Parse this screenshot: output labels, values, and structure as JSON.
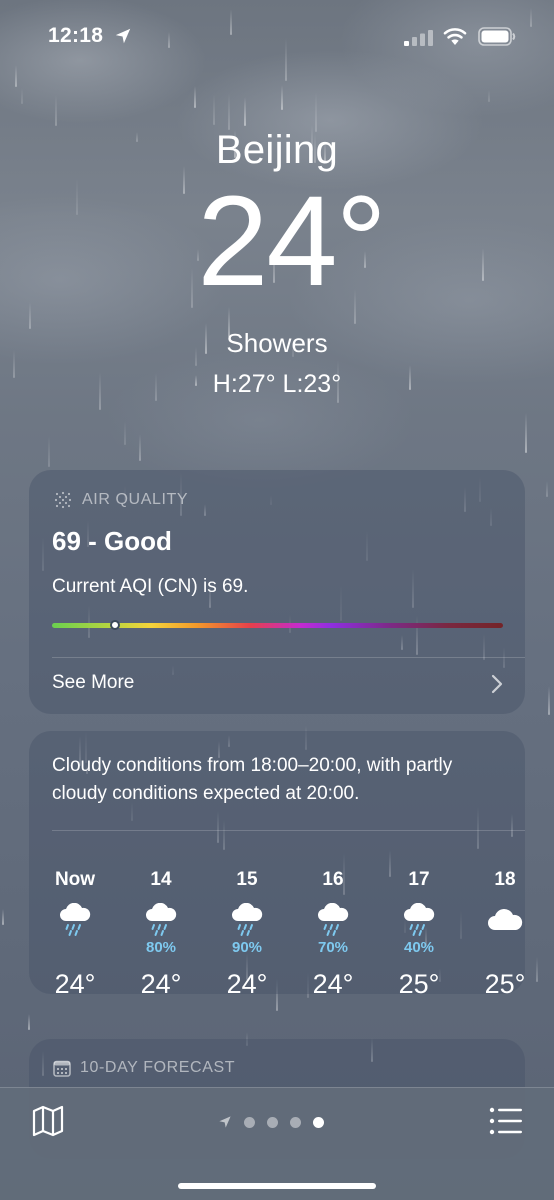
{
  "status_bar": {
    "time": "12:18",
    "location_icon": "location-arrow-icon",
    "signal_icon": "cellular-signal-icon",
    "wifi_icon": "wifi-icon",
    "battery_icon": "battery-icon"
  },
  "header": {
    "city": "Beijing",
    "temperature": "24°",
    "condition": "Showers",
    "high_low": "H:27°  L:23°"
  },
  "air_quality": {
    "icon": "air-quality-icon",
    "title": "AIR QUALITY",
    "value": "69 - Good",
    "description": "Current AQI (CN) is 69.",
    "scale_position": 0.14,
    "see_more_label": "See More",
    "chevron_icon": "chevron-right-icon"
  },
  "hourly": {
    "summary": "Cloudy conditions from 18:00–20:00, with partly cloudy conditions expected at 20:00.",
    "items": [
      {
        "label": "Now",
        "icon": "rain-cloud-icon",
        "precip": "",
        "temp": "24°"
      },
      {
        "label": "14",
        "icon": "rain-cloud-icon",
        "precip": "80%",
        "temp": "24°"
      },
      {
        "label": "15",
        "icon": "rain-cloud-icon",
        "precip": "90%",
        "temp": "24°"
      },
      {
        "label": "16",
        "icon": "rain-cloud-icon",
        "precip": "70%",
        "temp": "24°"
      },
      {
        "label": "17",
        "icon": "rain-cloud-icon",
        "precip": "40%",
        "temp": "25°"
      },
      {
        "label": "18",
        "icon": "cloud-icon",
        "precip": "",
        "temp": "25°"
      }
    ]
  },
  "forecast": {
    "icon": "calendar-icon",
    "title": "10-DAY FORECAST"
  },
  "bottom_bar": {
    "map_icon": "map-icon",
    "list_icon": "list-icon",
    "page_count": 4,
    "active_page": 3
  },
  "colors": {
    "precip": "#7ec9ef",
    "card_bg": "rgba(70,82,102,0.42)",
    "background": "#6a7380"
  }
}
